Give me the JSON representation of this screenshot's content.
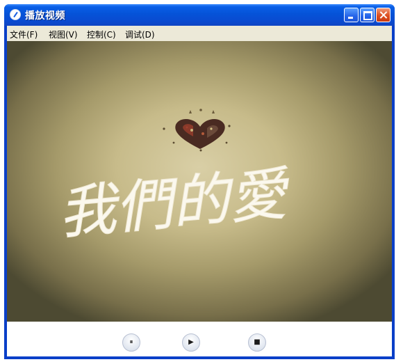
{
  "window": {
    "title": "播放视频"
  },
  "menu": {
    "items": [
      "文件(F)",
      "视图(V)",
      "控制(C)",
      "调试(D)"
    ]
  },
  "video": {
    "overlay_text": "我們的愛"
  },
  "controls": {
    "pause_icon": "⏸",
    "play_icon": "▶",
    "stop_icon": "■"
  },
  "colors": {
    "titlebar": "#0553d8",
    "close_button": "#dd4f21",
    "menu_bg": "#ece9d8"
  }
}
